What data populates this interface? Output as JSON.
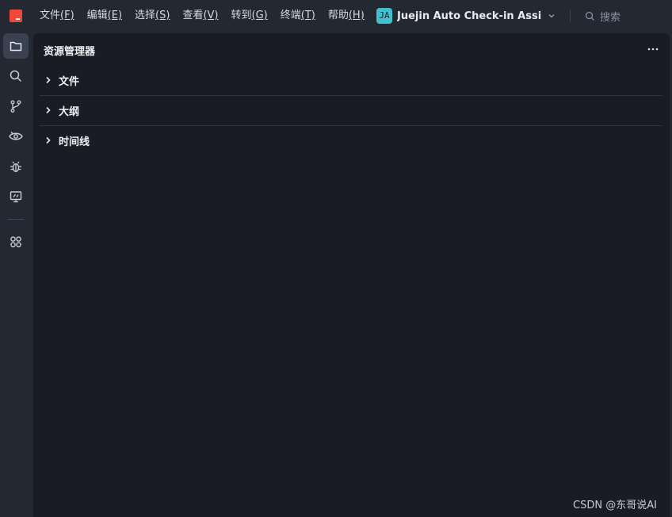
{
  "menu": [
    {
      "label": "文件",
      "key": "(F)"
    },
    {
      "label": "编辑",
      "key": "(E)"
    },
    {
      "label": "选择",
      "key": "(S)"
    },
    {
      "label": "查看",
      "key": "(V)"
    },
    {
      "label": "转到",
      "key": "(G)"
    },
    {
      "label": "终端",
      "key": "(T)"
    },
    {
      "label": "帮助",
      "key": "(H)"
    }
  ],
  "project": {
    "badge": "JA",
    "name": "Juejin Auto Check-in Assista..."
  },
  "search": {
    "label": "搜索"
  },
  "activity": [
    "explorer-icon",
    "search-icon",
    "source-control-icon",
    "preview-icon",
    "debug-icon",
    "remote-display-icon",
    "extensions-icon"
  ],
  "explorer": {
    "title": "资源管理器",
    "sections": [
      {
        "label": "文件"
      },
      {
        "label": "大纲"
      },
      {
        "label": "时间线"
      }
    ]
  },
  "watermark": "CSDN @东哥说AI",
  "colors": {
    "accent": "#f0483a",
    "badge": "#3fc1cf",
    "panel": "#191c24",
    "chrome": "#232833"
  }
}
